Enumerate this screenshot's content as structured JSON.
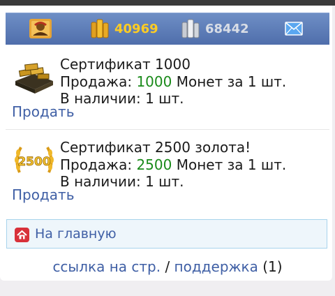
{
  "header": {
    "gold": "40969",
    "silver": "68442",
    "icons": [
      "avatar-icon",
      "gold-coins-icon",
      "silver-coins-icon",
      "mail-icon"
    ]
  },
  "items": [
    {
      "title": "Сертификат 1000",
      "price_prefix": "Продажа: ",
      "price": "1000",
      "price_suffix": " Монет за 1 шт.",
      "stock": "В наличии: 1 шт.",
      "sell": "Продать",
      "image": "gold-bars-icon"
    },
    {
      "title": "Сертификат 2500 золота!",
      "price_prefix": "Продажа: ",
      "price": "2500",
      "price_suffix": " Монет за 1 шт.",
      "stock": "В наличии: 1 шт.",
      "sell": "Продать",
      "image": "gold-2500-laurel-icon"
    }
  ],
  "nav": {
    "home": "На главную"
  },
  "footer": {
    "link1": "ссылка на стр.",
    "sep": " / ",
    "link2": "поддержка",
    "count": " (1)"
  },
  "colors": {
    "bar": "#5a7ab6",
    "gold": "#ffcc22",
    "link": "#3f5fa5",
    "price": "#1a8a1a"
  }
}
